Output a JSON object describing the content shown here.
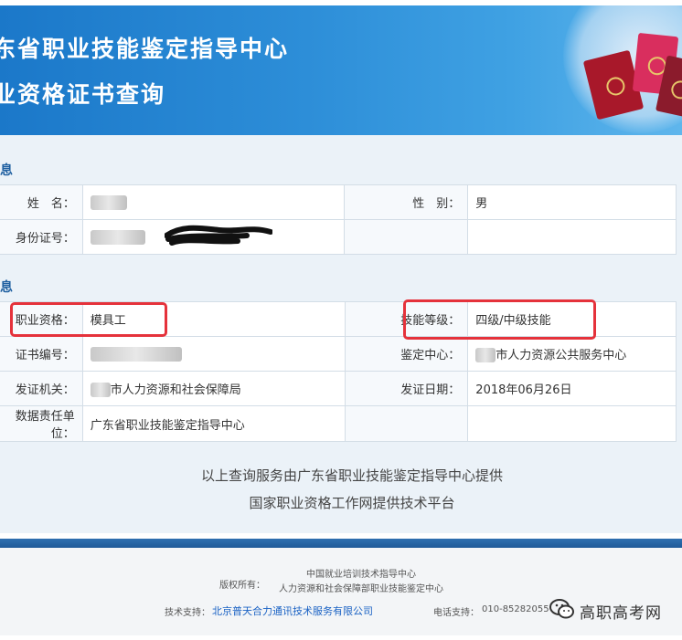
{
  "header": {
    "title_line1": "东省职业技能鉴定指导中心",
    "title_line2": "业资格证书查询"
  },
  "section_personal": {
    "title": "息",
    "name_label": "姓　名：",
    "gender_label": "性　别：",
    "gender_value": "男",
    "id_label": "身份证号："
  },
  "section_cert": {
    "title": "息",
    "qualification_label": "职业资格：",
    "qualification_value": "模具工",
    "skill_level_label": "技能等级：",
    "skill_level_value": "四级/中级技能",
    "cert_no_label": "证书编号：",
    "appraisal_center_label": "鉴定中心：",
    "appraisal_center_value": "市人力资源公共服务中心",
    "issuer_label": "发证机关：",
    "issuer_value": "市人力资源和社会保障局",
    "issue_date_label": "发证日期：",
    "issue_date_value": "2018年06月26日",
    "data_unit_label": "数据责任单位：",
    "data_unit_value": "广东省职业技能鉴定指导中心"
  },
  "footer_notes": {
    "line1": "以上查询服务由广东省职业技能鉴定指导中心提供",
    "line2": "国家职业资格工作网提供技术平台"
  },
  "copyright": {
    "label": "版权所有：",
    "owner1": "中国就业培训技术指导中心",
    "owner2": "人力资源和社会保障部职业技能鉴定中心",
    "support_label": "技术支持：",
    "support_value": "北京普天合力通讯技术服务有限公司",
    "phone_label": "电话支持：",
    "phone_value": "010-85282055"
  },
  "watermark": {
    "text": "高职高考网",
    "icon": "wechat-icon"
  },
  "colors": {
    "banner": "#2d8ed8",
    "section_title": "#1e5fa0",
    "highlight": "#e5323b",
    "link": "#1a62c4"
  }
}
